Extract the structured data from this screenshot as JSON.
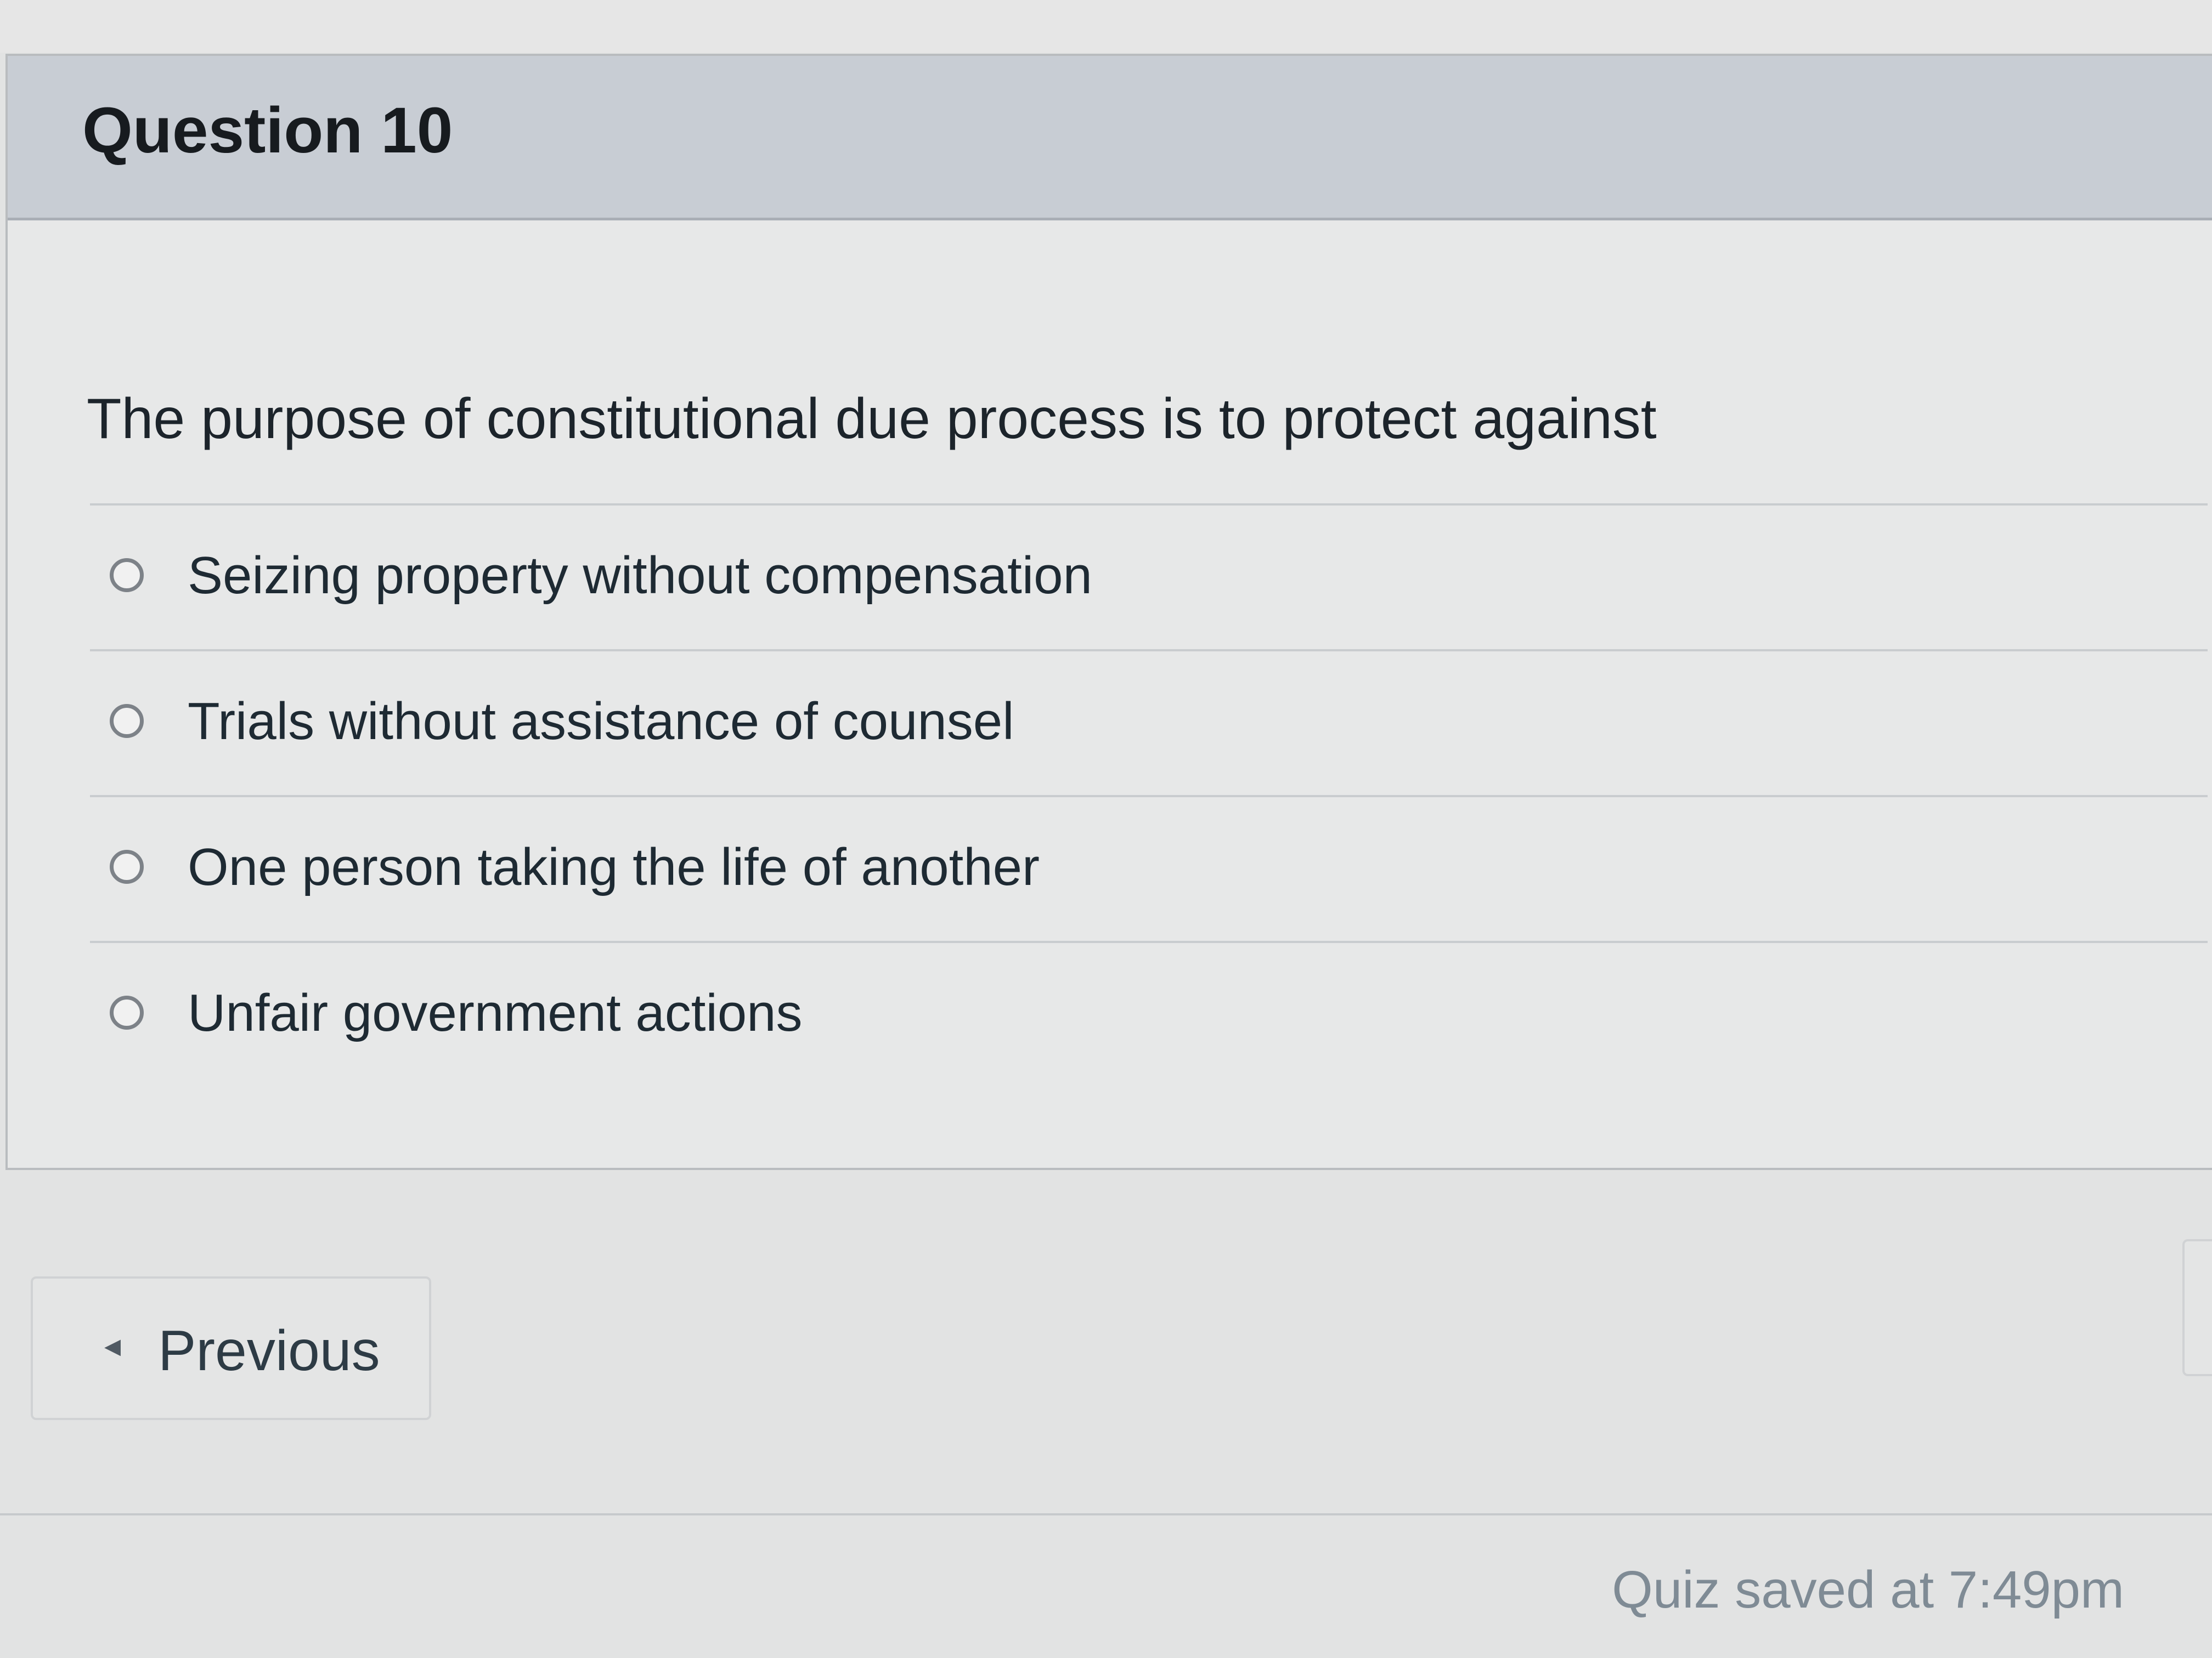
{
  "question": {
    "title": "Question 10",
    "text": "The purpose of constitutional due process is to protect against",
    "answers": [
      {
        "label": "Seizing property without compensation",
        "selected": false
      },
      {
        "label": "Trials without assistance of counsel",
        "selected": false
      },
      {
        "label": "One person taking the life of another",
        "selected": false
      },
      {
        "label": "Unfair government actions",
        "selected": false
      }
    ]
  },
  "navigation": {
    "previous_label": "Previous",
    "previous_icon": "caret-left-icon"
  },
  "status": {
    "saved_text": "Quiz saved at 7:49pm"
  },
  "colors": {
    "header_bg": "#c8cdd4",
    "card_bg": "#e7e8e8",
    "text": "#1c242b",
    "muted_text": "#7f8b95"
  }
}
